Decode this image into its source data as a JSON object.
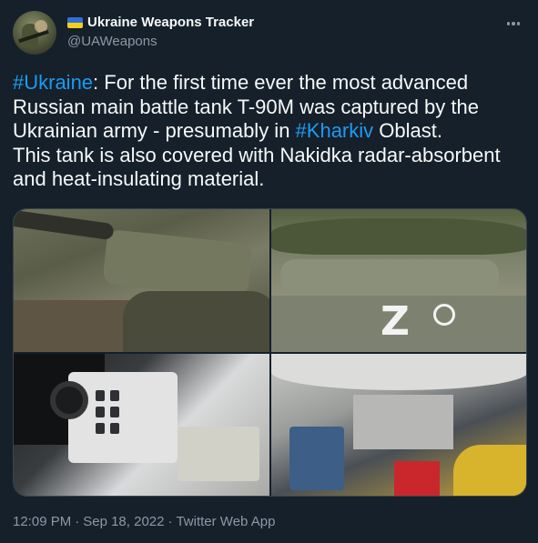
{
  "author": {
    "display_name": "Ukraine Weapons Tracker",
    "handle": "@UAWeapons",
    "flag_colors": [
      "#2f6fd6",
      "#f2cf1a"
    ]
  },
  "tweet": {
    "segments": [
      {
        "text": "#Ukraine",
        "type": "hashtag"
      },
      {
        "text": ": For the first time ever the most advanced Russian main battle tank T-90M was captured by the Ukrainian army - presumably in ",
        "type": "text"
      },
      {
        "text": "#Kharkiv",
        "type": "hashtag"
      },
      {
        "text": " Oblast.\nThis tank is also covered with Nakidka radar-absorbent and heat-insulating material.",
        "type": "text"
      }
    ]
  },
  "media": {
    "photos": [
      {
        "id": "photo-1",
        "alt": ""
      },
      {
        "id": "photo-2",
        "alt": ""
      },
      {
        "id": "photo-3",
        "alt": ""
      },
      {
        "id": "photo-4",
        "alt": ""
      }
    ],
    "photo2_mark": "Z"
  },
  "meta": {
    "time": "12:09 PM",
    "separator": "·",
    "date": "Sep 18, 2022",
    "source": "Twitter Web App"
  },
  "colors": {
    "background": "#15202b",
    "text": "#f7f9f9",
    "secondary": "#8b98a5",
    "accent": "#1d9bf0",
    "border": "#38444d"
  },
  "icons": {
    "more": "more-horizontal-icon"
  }
}
